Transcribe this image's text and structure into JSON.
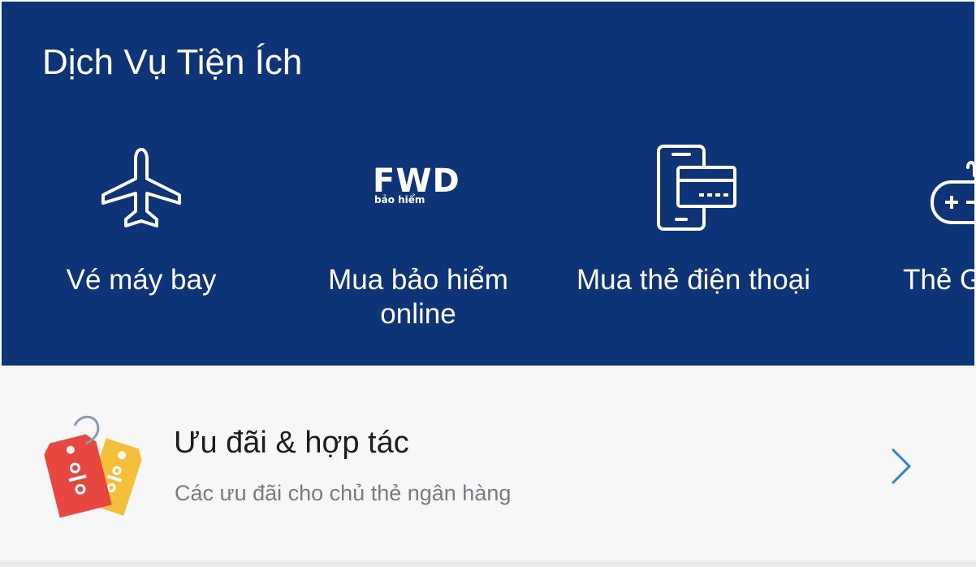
{
  "services": {
    "title": "Dịch Vụ Tiện Ích",
    "items": [
      {
        "label": "Vé máy bay",
        "icon": "airplane-icon"
      },
      {
        "label": "Mua bảo hiểm online",
        "icon": "fwd-logo",
        "logo_text": "FWD",
        "logo_subtext": "bảo hiểm"
      },
      {
        "label": "Mua thẻ điện thoại",
        "icon": "phone-card-icon"
      },
      {
        "label": "Thẻ G",
        "icon": "game-controller-icon"
      }
    ]
  },
  "promo": {
    "title": "Ưu đãi & hợp tác",
    "subtitle": "Các ưu đãi cho chủ thẻ ngân hàng",
    "icon": "discount-tags-icon"
  },
  "colors": {
    "panel_bg": "#0c3476",
    "accent": "#2d7fdc",
    "tag_red": "#e8473f",
    "tag_yellow": "#f4c03a"
  }
}
